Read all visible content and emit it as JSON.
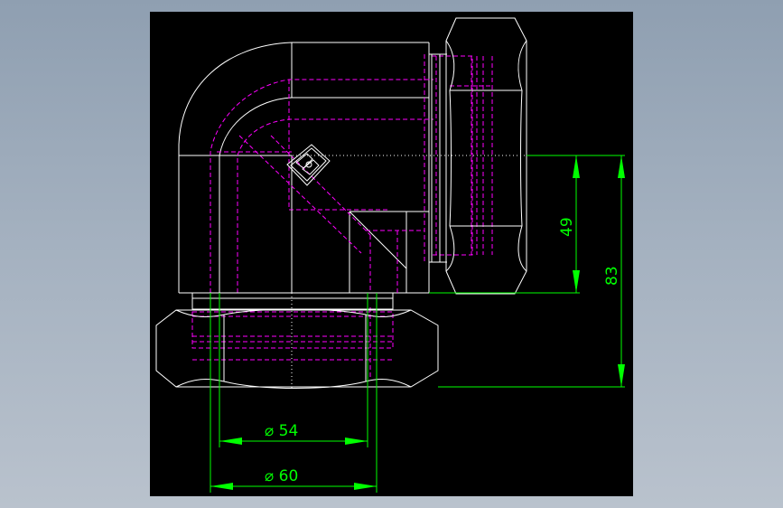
{
  "colors": {
    "background_outer": "#9aa8b8",
    "viewport": "#000000",
    "outline": "#ffffff",
    "hidden_lines": "#ff00ff",
    "dimensions": "#00ff00"
  },
  "dimensions": {
    "inner_diameter": "⌀ 54",
    "outer_diameter": "⌀ 60",
    "height_small": "49",
    "height_large": "83"
  }
}
